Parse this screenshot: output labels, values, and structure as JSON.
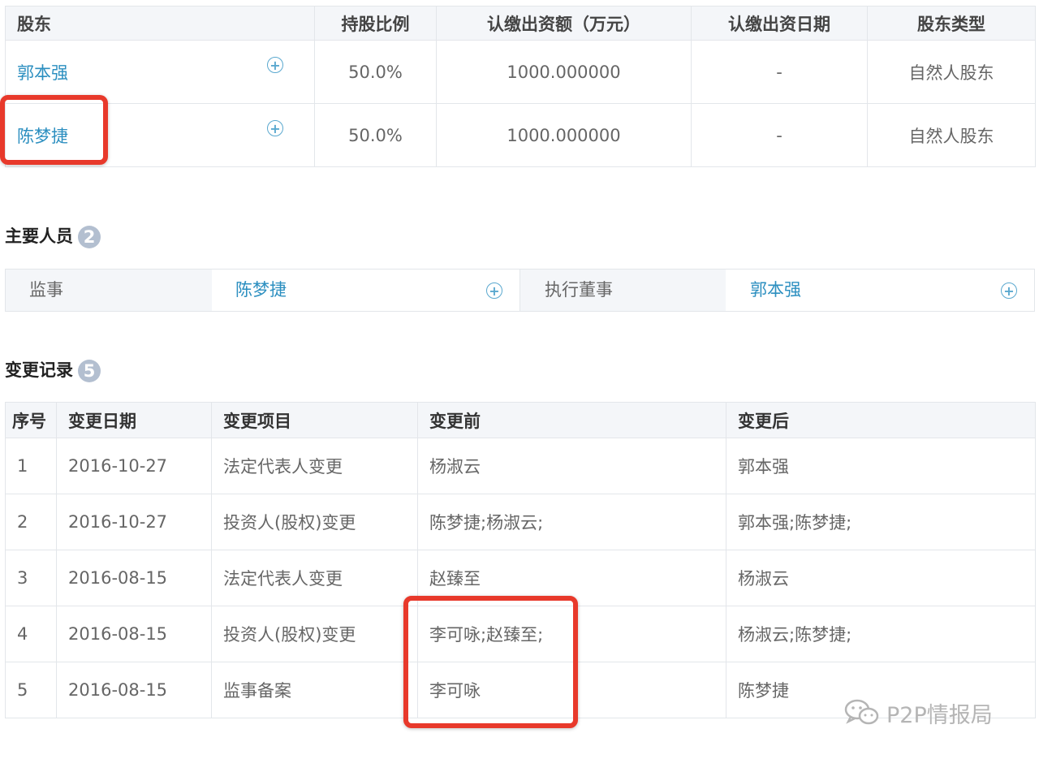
{
  "shareholders": {
    "headers": [
      "股东",
      "持股比例",
      "认缴出资额（万元）",
      "认缴出资日期",
      "股东类型"
    ],
    "rows": [
      {
        "name": "郭本强",
        "ratio": "50.0%",
        "amount": "1000.000000",
        "date": "-",
        "type": "自然人股东"
      },
      {
        "name": "陈梦捷",
        "ratio": "50.0%",
        "amount": "1000.000000",
        "date": "-",
        "type": "自然人股东"
      }
    ]
  },
  "staff": {
    "title": "主要人员",
    "count": "2",
    "entries": [
      {
        "role": "监事",
        "person": "陈梦捷"
      },
      {
        "role": "执行董事",
        "person": "郭本强"
      }
    ]
  },
  "changes": {
    "title": "变更记录",
    "count": "5",
    "headers": [
      "序号",
      "变更日期",
      "变更项目",
      "变更前",
      "变更后"
    ],
    "rows": [
      {
        "no": "1",
        "date": "2016-10-27",
        "item": "法定代表人变更",
        "before": "杨淑云",
        "after": "郭本强"
      },
      {
        "no": "2",
        "date": "2016-10-27",
        "item": "投资人(股权)变更",
        "before": "陈梦捷;杨淑云;",
        "after": "郭本强;陈梦捷;"
      },
      {
        "no": "3",
        "date": "2016-08-15",
        "item": "法定代表人变更",
        "before": "赵臻至",
        "after": "杨淑云"
      },
      {
        "no": "4",
        "date": "2016-08-15",
        "item": "投资人(股权)变更",
        "before": "李可咏;赵臻至;",
        "after": "杨淑云;陈梦捷;"
      },
      {
        "no": "5",
        "date": "2016-08-15",
        "item": "监事备案",
        "before": "李可咏",
        "after": "陈梦捷"
      }
    ]
  },
  "icons": {
    "expand": "plus-circle-icon",
    "watermark": "wechat-icon"
  },
  "colors": {
    "link": "#2c8fc0",
    "highlight": "#e8392b",
    "header_bg": "#f4f6f9",
    "badge": "#b3bfd0"
  },
  "watermark": {
    "text": "P2P情报局"
  }
}
